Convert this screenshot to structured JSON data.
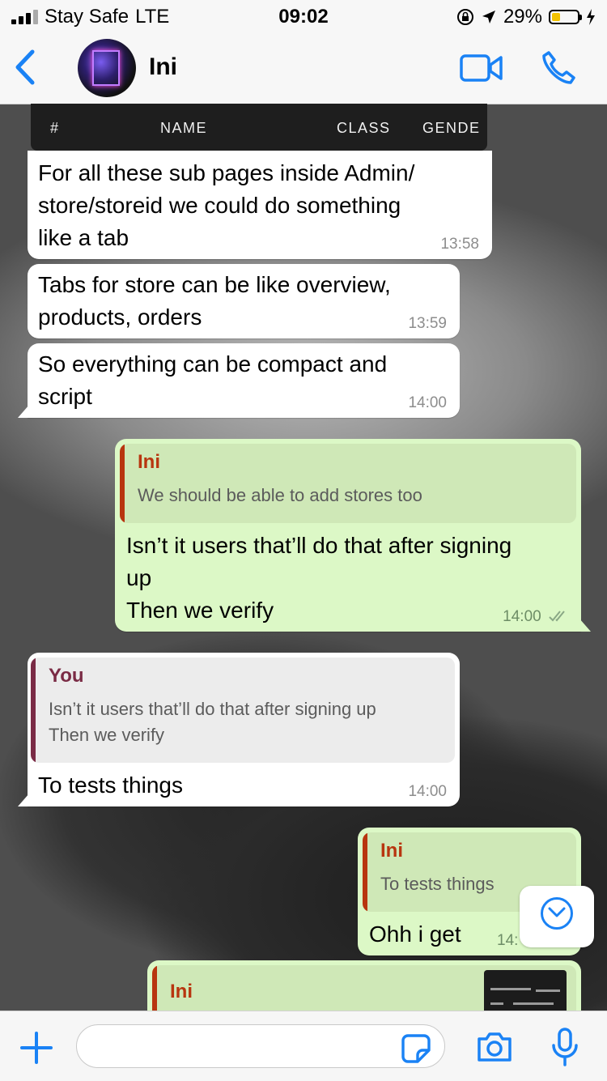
{
  "status": {
    "carrier": "Stay Safe",
    "network": "LTE",
    "time": "09:02",
    "battery": "29%",
    "battery_level": 0.29
  },
  "header": {
    "contact_name": "Ini"
  },
  "table_preview": {
    "columns": [
      "#",
      "NAME",
      "CLASS",
      "GENDE"
    ]
  },
  "messages": [
    {
      "text_lines": [
        "For all these sub pages inside Admin/",
        "store/storeid we could do something",
        "like a tab"
      ],
      "time": "13:58"
    },
    {
      "text_lines": [
        "Tabs for store can be like overview,",
        "products, orders"
      ],
      "time": "13:59"
    },
    {
      "text_lines": [
        "So everything can be compact and",
        "script"
      ],
      "time": "14:00"
    },
    {
      "quote_name": "Ini",
      "quote_text": "We should be able to add stores too",
      "text_lines": [
        "Isn’t it users that’ll do that after signing",
        "up",
        "Then we verify"
      ],
      "time": "14:00"
    },
    {
      "quote_name": "You",
      "quote_lines": [
        "Isn’t it users that’ll do that after signing up",
        "Then we verify"
      ],
      "text": "To tests things",
      "time": "14:00"
    },
    {
      "quote_name": "Ini",
      "quote_text": "To tests things",
      "text": "Ohh i get",
      "time": "14:"
    },
    {
      "quote_name": "Ini"
    }
  ],
  "colors": {
    "accent": "#1a82f5",
    "outgoing": "#dcf8c6",
    "incoming": "#ffffff",
    "quote_ini": "#b8350f",
    "quote_you": "#7a2b45"
  },
  "icons": {
    "back": "chevron-left-icon",
    "video": "video-camera-icon",
    "phone": "phone-icon",
    "scroll": "chevron-down-icon",
    "plus": "plus-icon",
    "sticker": "sticker-icon",
    "camera": "camera-icon",
    "mic": "microphone-icon"
  }
}
